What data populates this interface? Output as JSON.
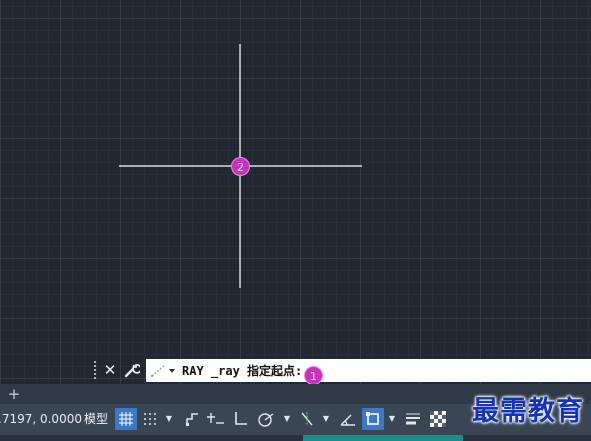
{
  "colors": {
    "viewport_bg": "#212830",
    "grid_major": "#333c47",
    "crosshair": "#ffffff",
    "badge": "#cc2fc0",
    "toggle_active": "#3c78c4",
    "progress": "#1d8c8c",
    "watermark": "#1433b8"
  },
  "badges": {
    "step_one": "1",
    "step_two": "2"
  },
  "command_line": {
    "close_icon": "close-icon",
    "customize_icon": "wrench-icon",
    "recent_icon": "recent-commands-icon",
    "prompt": "RAY _ray 指定起点:"
  },
  "layout_tabs": {
    "add_label": "+"
  },
  "status_bar": {
    "coordinates": ".7197, 0.0000",
    "model_label": "模型",
    "toggles": [
      {
        "name": "grid",
        "icon": "grid-icon",
        "active": true
      },
      {
        "name": "snap",
        "icon": "snap-icon",
        "active": false
      },
      {
        "name": "infer",
        "icon": "infer-constraints-icon",
        "active": false
      },
      {
        "name": "dynamic-input",
        "icon": "dynamic-input-icon",
        "active": false
      },
      {
        "name": "ortho",
        "icon": "ortho-icon",
        "active": false
      },
      {
        "name": "polar",
        "icon": "polar-tracking-icon",
        "active": false
      },
      {
        "name": "osnap-tracking",
        "icon": "object-snap-tracking-icon",
        "active": false
      },
      {
        "name": "isodraft",
        "icon": "isodraft-icon",
        "active": false
      },
      {
        "name": "osnap",
        "icon": "object-snap-icon",
        "active": true
      },
      {
        "name": "lineweight",
        "icon": "lineweight-icon",
        "active": false
      },
      {
        "name": "transparency",
        "icon": "transparency-icon",
        "active": false
      }
    ]
  },
  "watermark": "最需教育"
}
